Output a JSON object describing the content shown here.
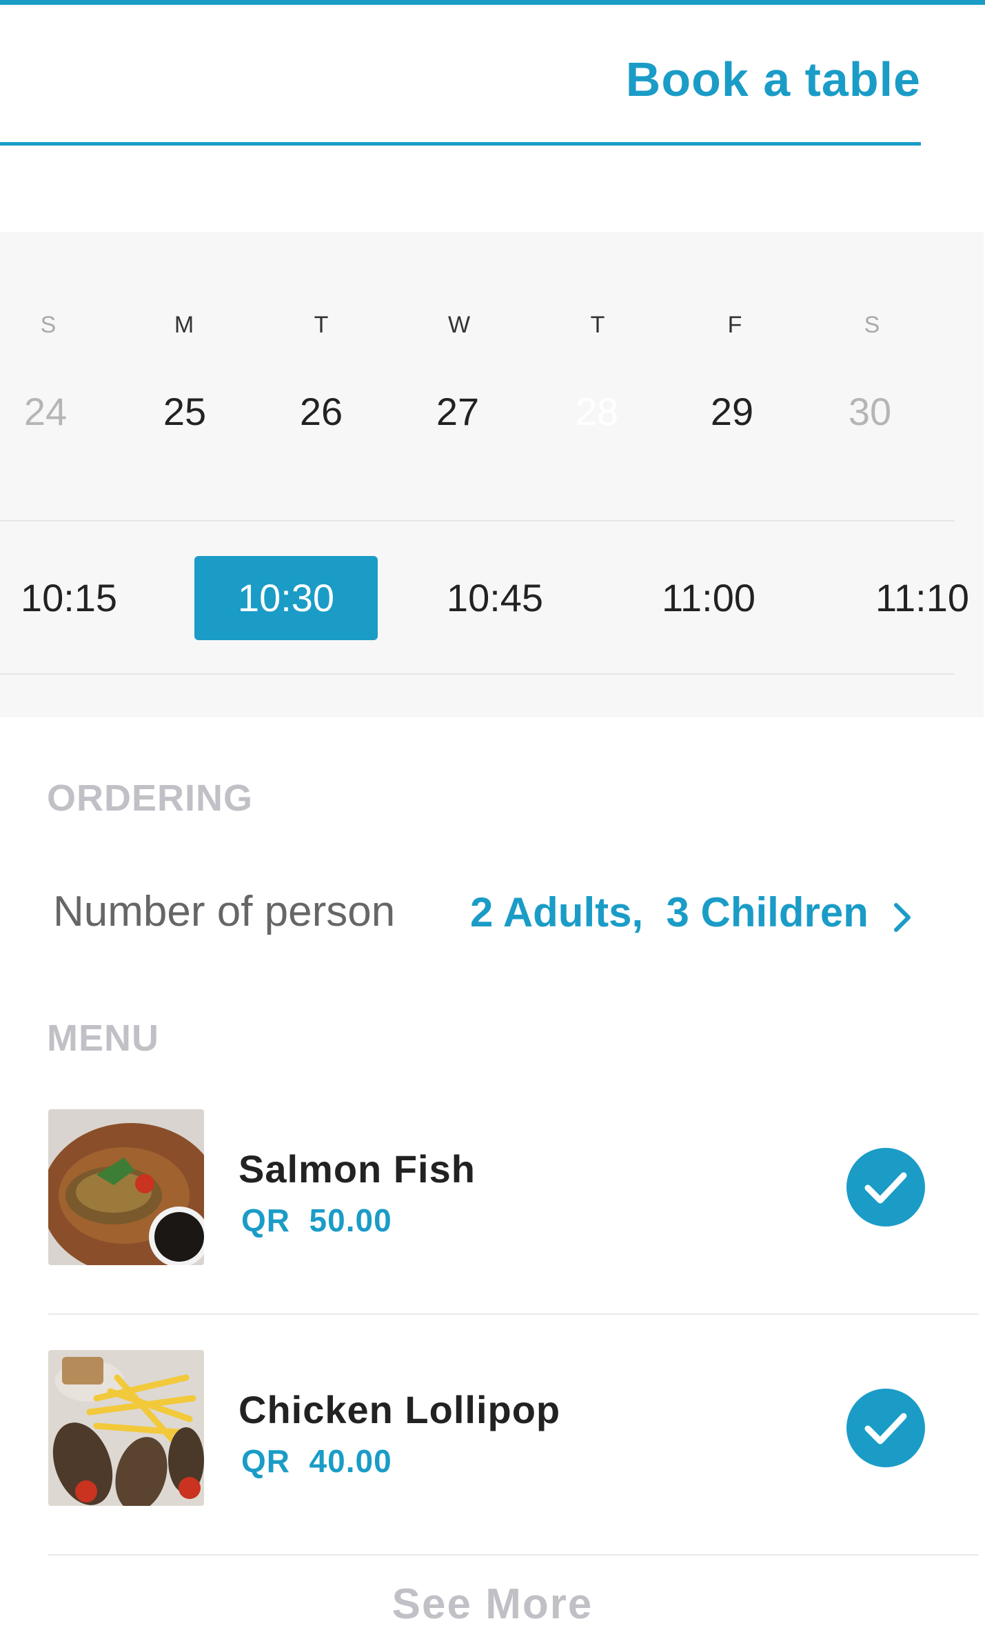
{
  "header": {
    "title": "Book a table"
  },
  "calendar": {
    "days": [
      {
        "letter": "S",
        "date": "24",
        "state": "muted"
      },
      {
        "letter": "M",
        "date": "25",
        "state": "normal"
      },
      {
        "letter": "T",
        "date": "26",
        "state": "normal"
      },
      {
        "letter": "W",
        "date": "27",
        "state": "normal"
      },
      {
        "letter": "T",
        "date": "28",
        "state": "selected"
      },
      {
        "letter": "F",
        "date": "29",
        "state": "normal"
      },
      {
        "letter": "S",
        "date": "30",
        "state": "muted"
      }
    ]
  },
  "times": [
    {
      "label": "10:15",
      "selected": false
    },
    {
      "label": "10:30",
      "selected": true
    },
    {
      "label": "10:45",
      "selected": false
    },
    {
      "label": "11:00",
      "selected": false
    },
    {
      "label": "11:10",
      "selected": false
    }
  ],
  "ordering": {
    "section_label": "ORDERING",
    "persons_label": "Number of person",
    "persons_value": "2 Adults,  3 Children",
    "chevron_icon": "chevron-right-icon"
  },
  "menu": {
    "section_label": "MENU",
    "items": [
      {
        "name": "Salmon Fish",
        "price": "QR  50.00",
        "checked": true,
        "image": "grilled-fish-photo"
      },
      {
        "name": "Chicken Lollipop",
        "price": "QR  40.00",
        "checked": true,
        "image": "chicken-fries-photo"
      }
    ],
    "see_more": "See More"
  },
  "colors": {
    "accent": "#1a9cc7",
    "muted_label": "#c0c0c6"
  }
}
